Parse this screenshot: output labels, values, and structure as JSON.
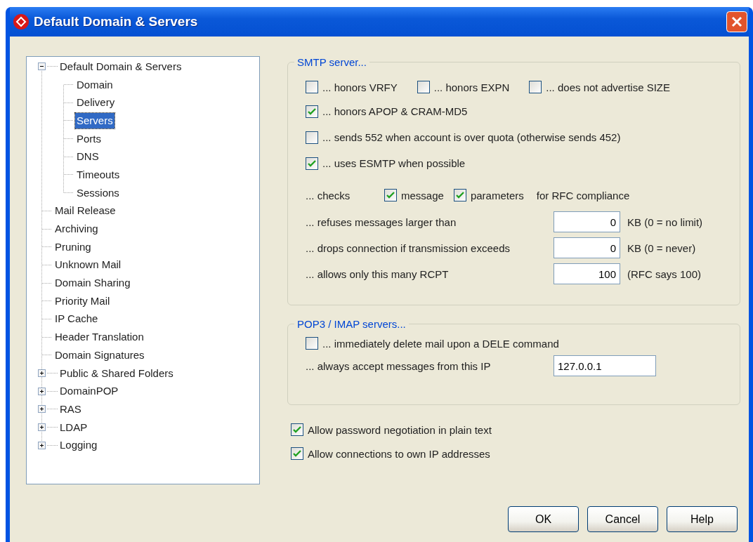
{
  "window": {
    "title": "Default Domain & Servers"
  },
  "tree": [
    {
      "label": "Default Domain & Servers",
      "selected": false,
      "expanded": true,
      "children": [
        {
          "label": "Domain",
          "selected": false
        },
        {
          "label": "Delivery",
          "selected": false
        },
        {
          "label": "Servers",
          "selected": true
        },
        {
          "label": "Ports",
          "selected": false
        },
        {
          "label": "DNS",
          "selected": false
        },
        {
          "label": "Timeouts",
          "selected": false
        },
        {
          "label": "Sessions",
          "selected": false
        }
      ]
    },
    {
      "label": "Mail Release",
      "selected": false
    },
    {
      "label": "Archiving",
      "selected": false
    },
    {
      "label": "Pruning",
      "selected": false
    },
    {
      "label": "Unknown Mail",
      "selected": false
    },
    {
      "label": "Domain Sharing",
      "selected": false
    },
    {
      "label": "Priority Mail",
      "selected": false
    },
    {
      "label": "IP Cache",
      "selected": false
    },
    {
      "label": "Header Translation",
      "selected": false
    },
    {
      "label": "Domain Signatures",
      "selected": false
    },
    {
      "label": "Public & Shared Folders",
      "selected": false,
      "expanded": false
    },
    {
      "label": "DomainPOP",
      "selected": false,
      "expanded": false
    },
    {
      "label": "RAS",
      "selected": false,
      "expanded": false
    },
    {
      "label": "LDAP",
      "selected": false,
      "expanded": false
    },
    {
      "label": "Logging",
      "selected": false,
      "expanded": false
    }
  ],
  "smtp": {
    "legend": "SMTP server...",
    "top_options": [
      {
        "label": "... honors VRFY",
        "checked": false
      },
      {
        "label": "... honors EXPN",
        "checked": false
      },
      {
        "label": "... does not advertise SIZE",
        "checked": false
      }
    ],
    "options": [
      {
        "label": "... honors APOP & CRAM-MD5",
        "checked": true
      },
      {
        "label": "... sends 552 when account is over quota (otherwise sends 452)",
        "checked": false
      },
      {
        "label": "... uses ESMTP when possible",
        "checked": true
      }
    ],
    "checks": {
      "label": "... checks",
      "options": [
        {
          "label": "message",
          "checked": true
        },
        {
          "label": "parameters",
          "checked": true
        }
      ],
      "suffix": "for RFC compliance"
    },
    "limits": [
      {
        "label": "... refuses messages larger than",
        "value": "0",
        "note": "KB (0 = no limit)"
      },
      {
        "label": "... drops connection if transmission exceeds",
        "value": "0",
        "note": "KB (0 = never)"
      },
      {
        "label": "... allows only this many RCPT",
        "value": "100",
        "note": "(RFC says 100)"
      }
    ]
  },
  "pop": {
    "legend": "POP3 / IMAP servers...",
    "options": [
      {
        "label": "... immediately delete mail upon a DELE command",
        "checked": false
      }
    ],
    "ip": {
      "label": "... always accept messages from this IP",
      "value": "127.0.0.1"
    }
  },
  "options": [
    {
      "label": "Allow password negotiation in plain text",
      "checked": true
    },
    {
      "label": "Allow connections to own IP addresses",
      "checked": true
    }
  ],
  "buttons": [
    "OK",
    "Cancel",
    "Help"
  ]
}
